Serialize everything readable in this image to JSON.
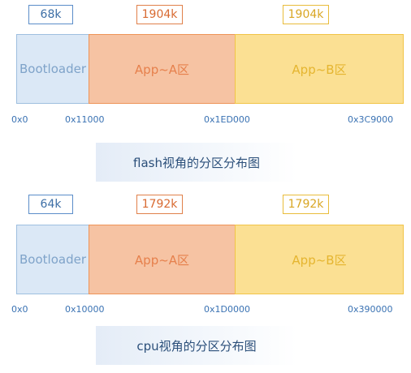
{
  "flash": {
    "sizes": {
      "boot": "68k",
      "app_a": "1904k",
      "app_b": "1904k"
    },
    "segments": {
      "boot": "Bootloader",
      "app_a": "App~A区",
      "app_b": "App~B区"
    },
    "addresses": {
      "a0": "0x0",
      "a1": "0x11000",
      "a2": "0x1ED000",
      "a3": "0x3C9000"
    },
    "caption": "flash视角的分区分布图"
  },
  "cpu": {
    "sizes": {
      "boot": "64k",
      "app_a": "1792k",
      "app_b": "1792k"
    },
    "segments": {
      "boot": "Bootloader",
      "app_a": "App~A区",
      "app_b": "App~B区"
    },
    "addresses": {
      "a0": "0x0",
      "a1": "0x10000",
      "a2": "0x1D0000",
      "a3": "0x390000"
    },
    "caption": "cpu视角的分区分布图"
  },
  "colors": {
    "bootloader_fill": "#dbe8f6",
    "app_a_fill": "#f6c3a3",
    "app_b_fill": "#fbe093",
    "address_text": "#3a72b3"
  }
}
